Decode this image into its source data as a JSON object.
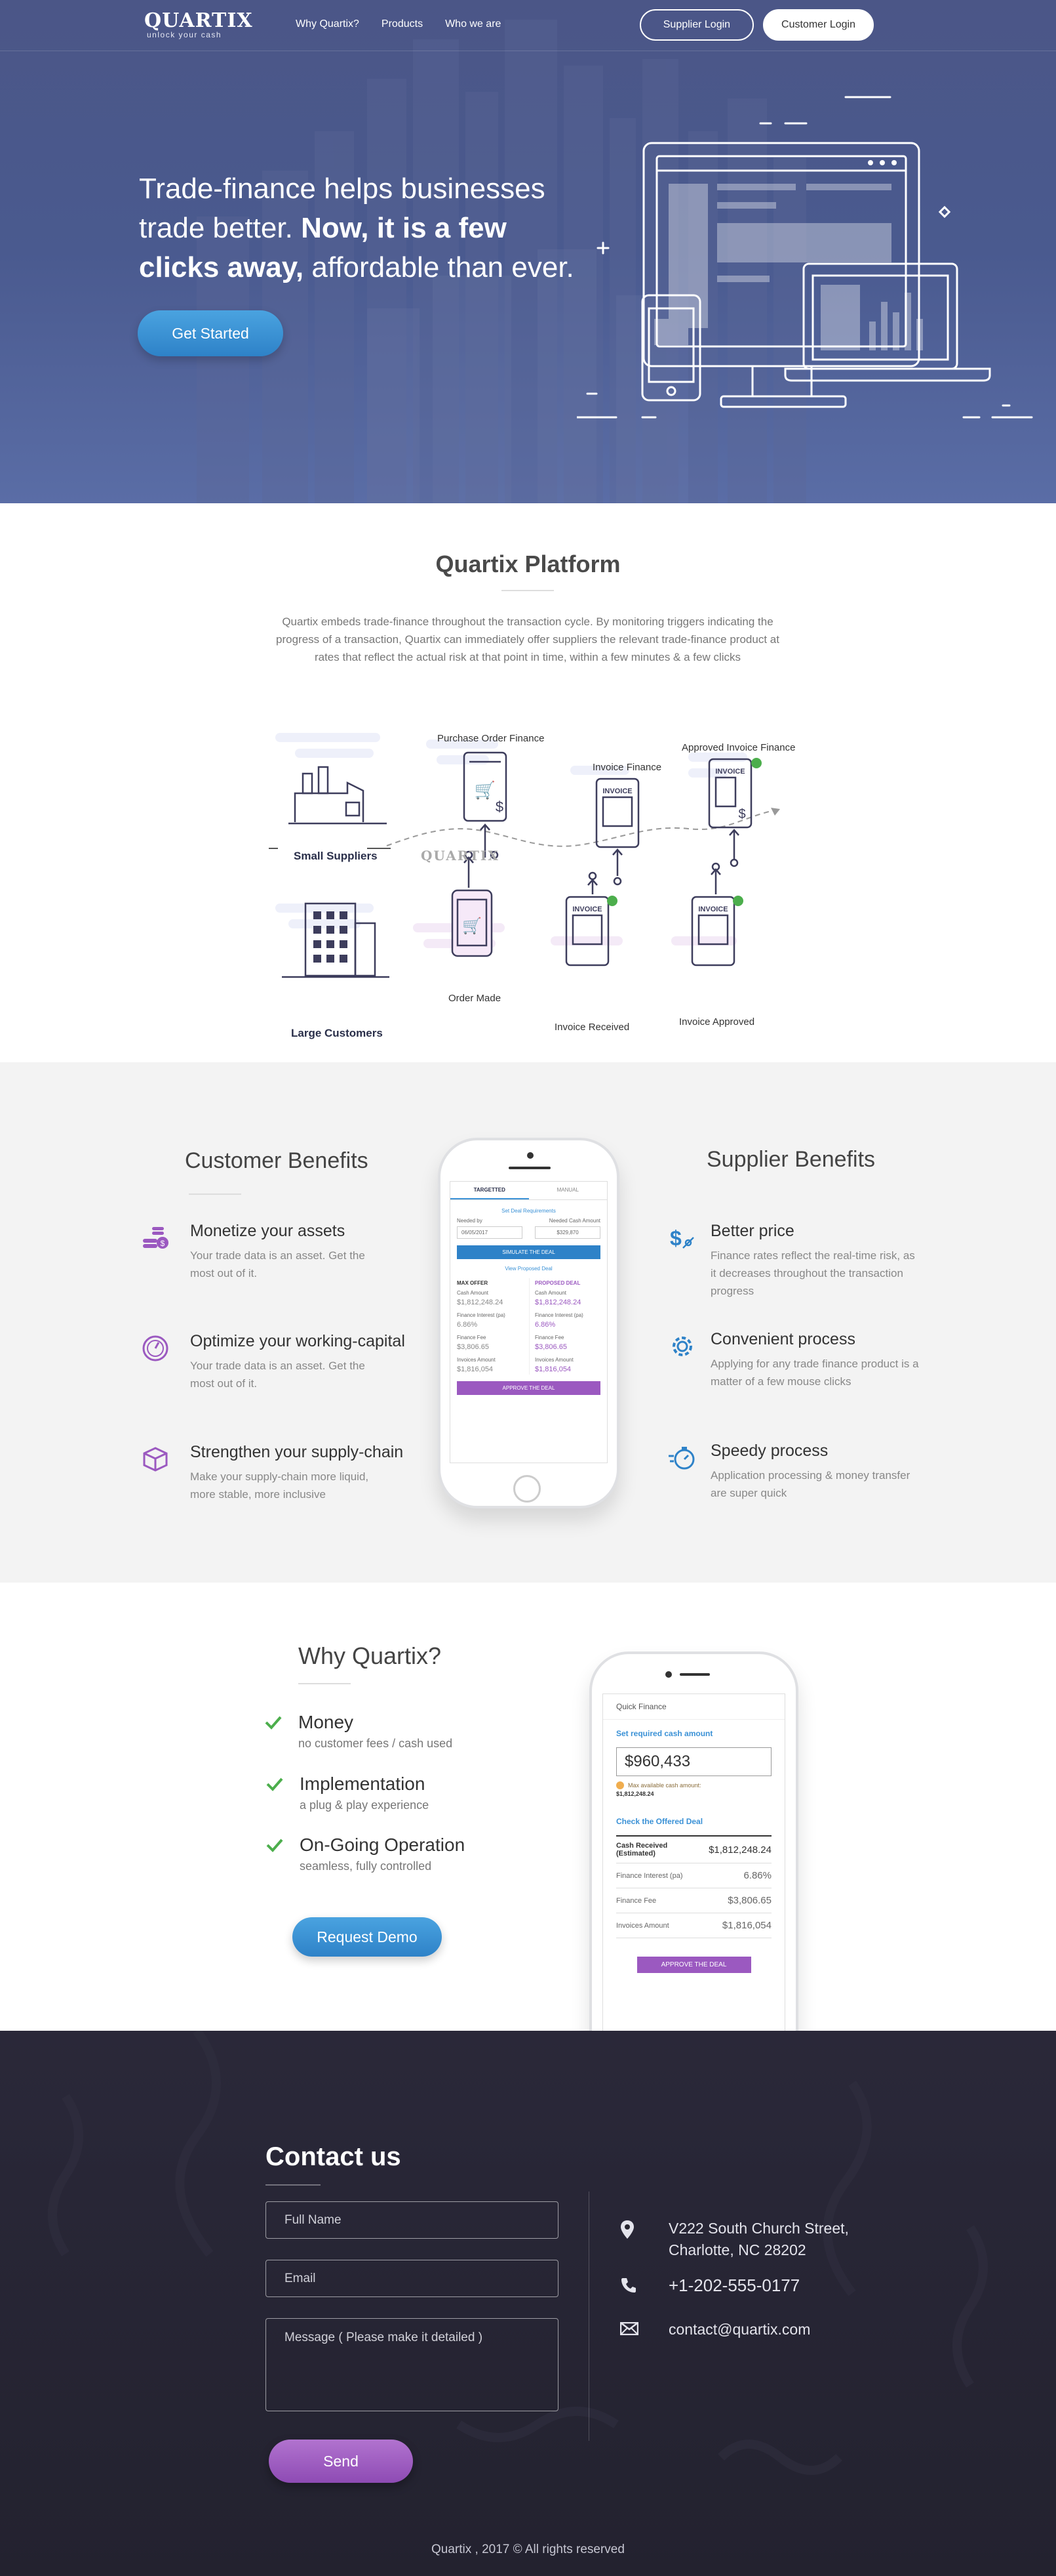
{
  "nav": {
    "logo": "QUARTIX",
    "tagline": "unlock your cash",
    "links": [
      "Why Quartix?",
      "Products",
      "Who we are"
    ],
    "supplier_login": "Supplier Login",
    "customer_login": "Customer Login"
  },
  "hero": {
    "headline_1": "Trade-finance helps businesses",
    "headline_2": " trade better. ",
    "headline_bold_1": "Now, it is a few",
    "headline_bold_2": "clicks away,",
    "headline_3": " affordable than ever.",
    "cta": "Get Started"
  },
  "platform": {
    "title": "Quartix Platform",
    "description": "Quartix embeds trade-finance throughout the  transaction cycle. By monitoring triggers indicating the progress of a transaction,  Quartix can immediately offer suppliers the relevant trade-finance product at rates that reflect the actual risk at that point in time, within a few minutes & a few clicks",
    "diagram": {
      "small_suppliers": "Small Suppliers",
      "large_customers": "Large Customers",
      "brand": "QUARTIX",
      "po_finance": "Purchase Order Finance",
      "invoice_finance": "Invoice Finance",
      "approved_invoice_finance": "Approved Invoice Finance",
      "order_made": "Order Made",
      "invoice_received": "Invoice Received",
      "invoice_approved": "Invoice Approved",
      "invoice_word": "INVOICE"
    }
  },
  "customer_benefits": {
    "title": "Customer Benefits",
    "items": [
      {
        "title": "Monetize your assets",
        "text": "Your trade data is an asset. Get the most out of it."
      },
      {
        "title": "Optimize your working-capital",
        "text": "Your trade data is an asset. Get the most out of it."
      },
      {
        "title": "Strengthen your supply-chain",
        "text": "Make your supply-chain more liquid, more stable, more inclusive"
      }
    ]
  },
  "supplier_benefits": {
    "title": "Supplier Benefits",
    "items": [
      {
        "title": "Better price",
        "text": "Finance rates reflect the real-time risk, as it decreases throughout the  transaction progress"
      },
      {
        "title": "Convenient process",
        "text": "Applying for any trade finance product is a matter of a few mouse clicks"
      },
      {
        "title": "Speedy process",
        "text": "Application processing & money transfer are super quick"
      }
    ]
  },
  "phone1": {
    "tab_targeted": "TARGETTED",
    "tab_manual": "MANUAL",
    "set_req": "Set Deal Requirements",
    "needed_by_label": "Needed by",
    "needed_by": "06/05/2017",
    "needed_cash_label": "Needed Cash Amount",
    "needed_cash": "$329,870",
    "simulate": "SIMULATE THE DEAL",
    "view_proposed": "View Proposed Deal",
    "max_offer": "MAX OFFER",
    "proposed_deal": "PROPOSED DEAL",
    "cash_amount_label": "Cash Amount",
    "max_cash": "$1,812,248.24",
    "prop_cash": "$1,812,248.24",
    "fin_interest_label": "Finance Interest (pa)",
    "max_interest": "6.86%",
    "prop_interest": "6.86%",
    "fin_fee_label": "Finance Fee",
    "max_fee": "$3,806.65",
    "prop_fee": "$3,806.65",
    "inv_amount_label": "Invoices Amount",
    "max_inv": "$1,816,054",
    "prop_inv": "$1,816,054",
    "approve": "APPROVE THE DEAL"
  },
  "why": {
    "title": "Why Quartix?",
    "items": [
      {
        "title": "Money",
        "text": "no customer fees / cash used"
      },
      {
        "title": "Implementation",
        "text": "a plug & play experience"
      },
      {
        "title": "On-Going Operation",
        "text": "seamless, fully controlled"
      }
    ],
    "cta": "Request Demo"
  },
  "phone2": {
    "header": "Quick Finance",
    "set_required": "Set required cash amount",
    "amount": "$960,433",
    "max_available_label": "Max available cash amount:",
    "max_available": "$1,812,248.24",
    "check_offered": "Check the Offered Deal",
    "cash_received_label": "Cash Received (Estimated)",
    "cash_received": "$1,812,248.24",
    "interest_label": "Finance Interest (pa)",
    "interest": "6.86%",
    "fee_label": "Finance Fee",
    "fee": "$3,806.65",
    "invoices_label": "Invoices Amount",
    "invoices": "$1,816,054",
    "approve": "APPROVE THE DEAL"
  },
  "contact": {
    "title": "Contact us",
    "name_placeholder": "Full Name",
    "email_placeholder": "Email",
    "message_placeholder": "Message ( Please make it detailed )",
    "send": "Send",
    "address_1": "V222 South Church Street,",
    "address_2": "Charlotte, NC 28202",
    "phone": "+1-202-555-0177",
    "email": "contact@quartix.com",
    "copyright": "Quartix , 2017 © All rights reserved"
  },
  "colors": {
    "hero_bg": "#4b5687",
    "primary_blue": "#3a91d6",
    "purple": "#9b59c0",
    "green_check": "#4cae4c",
    "contact_bg": "#26252f"
  }
}
